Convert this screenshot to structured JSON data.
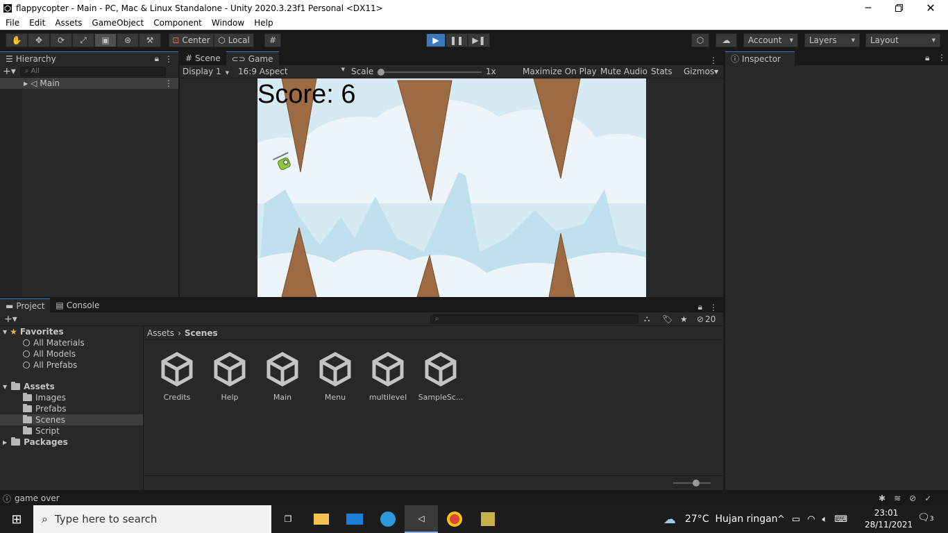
{
  "window": {
    "title": "flappycopter - Main - PC, Mac & Linux Standalone - Unity 2020.3.23f1 Personal <DX11>"
  },
  "menu": [
    "File",
    "Edit",
    "Assets",
    "GameObject",
    "Component",
    "Window",
    "Help"
  ],
  "toolbar": {
    "pivot": "Center",
    "space": "Local",
    "account": "Account",
    "layers": "Layers",
    "layout": "Layout"
  },
  "hierarchy": {
    "tab": "Hierarchy",
    "search_placeholder": "All",
    "scene": "Main"
  },
  "scene_tabs": {
    "scene": "Scene",
    "game": "Game"
  },
  "game_bar": {
    "display": "Display 1",
    "aspect": "16:9 Aspect",
    "scale_label": "Scale",
    "scale_value": "1x",
    "maximize": "Maximize On Play",
    "mute": "Mute Audio",
    "stats": "Stats",
    "gizmos": "Gizmos"
  },
  "game": {
    "score_text": "Score: 6"
  },
  "inspector": {
    "tab": "Inspector"
  },
  "project": {
    "tab": "Project",
    "console_tab": "Console",
    "hidden_count": "20",
    "favorites_label": "Favorites",
    "favorites": [
      "All Materials",
      "All Models",
      "All Prefabs"
    ],
    "assets_label": "Assets",
    "asset_folders": [
      "Images",
      "Prefabs",
      "Scenes",
      "Script"
    ],
    "packages_label": "Packages",
    "breadcrumb": {
      "root": "Assets",
      "current": "Scenes"
    },
    "items": [
      "Credits",
      "Help",
      "Main",
      "Menu",
      "multilevel",
      "SampleSc..."
    ]
  },
  "status": {
    "message": "game over"
  },
  "taskbar": {
    "search_placeholder": "Type here to search",
    "weather": "27°C  Hujan ringan",
    "time": "23:01",
    "date": "28/11/2021",
    "notifications": "3"
  },
  "colors": {
    "accent": "#3a79bb",
    "sky": "#d6eaf3",
    "rock": "#9c6b43"
  }
}
